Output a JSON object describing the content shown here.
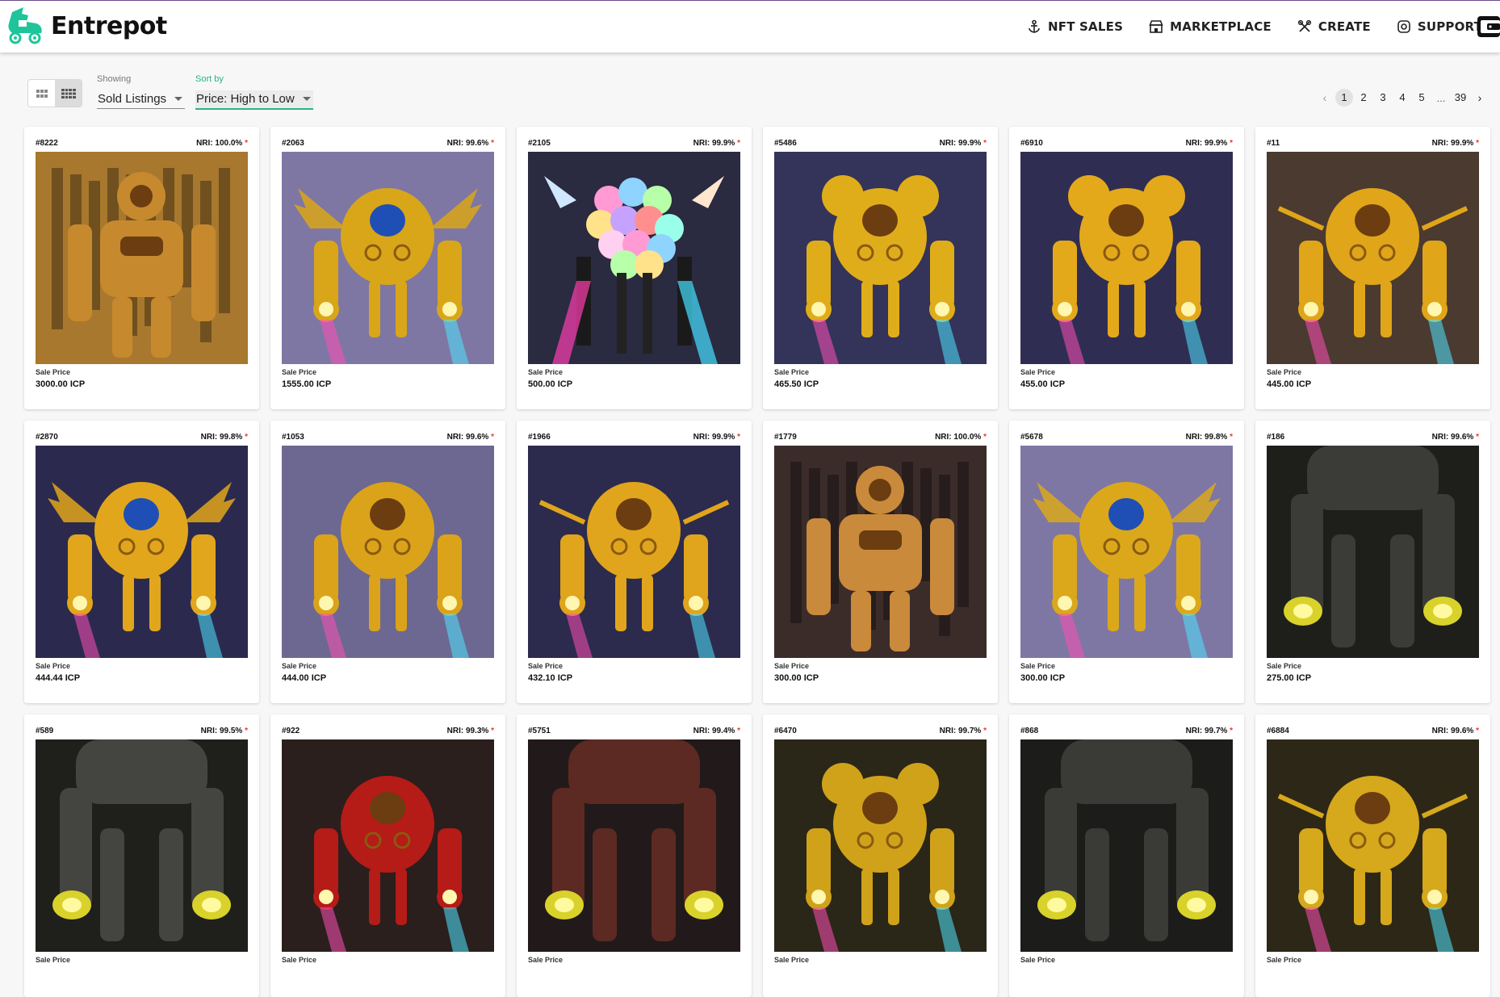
{
  "header": {
    "brand": "Entrepot",
    "brand_color": "#1ec59a",
    "nav": [
      {
        "label": "NFT SALES",
        "icon": "anchor-icon"
      },
      {
        "label": "MARKETPLACE",
        "icon": "store-icon"
      },
      {
        "label": "CREATE",
        "icon": "tools-icon"
      },
      {
        "label": "SUPPORT",
        "icon": "lifebuoy-icon"
      }
    ],
    "wallet_icon": "wallet-icon"
  },
  "toolbar": {
    "view_modes": [
      "large-grid-icon",
      "small-grid-icon"
    ],
    "showing_label": "Showing",
    "showing_value": "Sold Listings",
    "sort_label": "Sort by",
    "sort_value": "Price: High to Low",
    "accent": "#2bb28a"
  },
  "pagination": {
    "prev": "‹",
    "pages": [
      "1",
      "2",
      "3",
      "4",
      "5"
    ],
    "ellipsis": "...",
    "last": "39",
    "next": "›",
    "current": "1"
  },
  "cards": [
    {
      "id": "#8222",
      "nri": "NRI: 100.0%",
      "sale_label": "Sale Price",
      "price": "3000.00 ICP",
      "bg": "#a8782e",
      "body": "#c7892e",
      "variant": "ornate"
    },
    {
      "id": "#2063",
      "nri": "NRI: 99.6%",
      "sale_label": "Sale Price",
      "price": "1555.00 ICP",
      "bg": "#7e77a3",
      "body": "#d9a619",
      "variant": "winged"
    },
    {
      "id": "#2105",
      "nri": "NRI: 99.9%",
      "sale_label": "Sale Price",
      "price": "500.00 ICP",
      "bg": "#2a2a40",
      "body": "#9b7fd1",
      "variant": "balloons"
    },
    {
      "id": "#5486",
      "nri": "NRI: 99.9%",
      "sale_label": "Sale Price",
      "price": "465.50 ICP",
      "bg": "#343359",
      "body": "#e0ad1a",
      "variant": "eared"
    },
    {
      "id": "#6910",
      "nri": "NRI: 99.9%",
      "sale_label": "Sale Price",
      "price": "455.00 ICP",
      "bg": "#2f2e52",
      "body": "#e3a91b",
      "variant": "eared"
    },
    {
      "id": "#11",
      "nri": "NRI: 99.9%",
      "sale_label": "Sale Price",
      "price": "445.00 ICP",
      "bg": "#4a3a30",
      "body": "#e0a519",
      "variant": "spiked"
    },
    {
      "id": "#2870",
      "nri": "NRI: 99.8%",
      "sale_label": "Sale Price",
      "price": "444.44 ICP",
      "bg": "#2b2a4e",
      "body": "#e2a61c",
      "variant": "winged"
    },
    {
      "id": "#1053",
      "nri": "NRI: 99.6%",
      "sale_label": "Sale Price",
      "price": "444.00 ICP",
      "bg": "#6d6891",
      "body": "#dba31a",
      "variant": "tall"
    },
    {
      "id": "#1966",
      "nri": "NRI: 99.9%",
      "sale_label": "Sale Price",
      "price": "432.10 ICP",
      "bg": "#2c2b4d",
      "body": "#e0a51c",
      "variant": "spiked"
    },
    {
      "id": "#1779",
      "nri": "NRI: 100.0%",
      "sale_label": "Sale Price",
      "price": "300.00 ICP",
      "bg": "#3b2c2a",
      "body": "#c98a3c",
      "variant": "ornate"
    },
    {
      "id": "#5678",
      "nri": "NRI: 99.8%",
      "sale_label": "Sale Price",
      "price": "300.00 ICP",
      "bg": "#7e77a4",
      "body": "#dba81c",
      "variant": "winged"
    },
    {
      "id": "#186",
      "nri": "NRI: 99.6%",
      "sale_label": "Sale Price",
      "price": "275.00 ICP",
      "bg": "#1e1f1a",
      "body": "#3b3b38",
      "variant": "dark"
    },
    {
      "id": "#589",
      "nri": "NRI: 99.5%",
      "sale_label": "Sale Price",
      "price": "",
      "bg": "#1f1f1c",
      "body": "#444440",
      "variant": "dark"
    },
    {
      "id": "#922",
      "nri": "NRI: 99.3%",
      "sale_label": "Sale Price",
      "price": "",
      "bg": "#2a1f1d",
      "body": "#b51b17",
      "variant": "tall"
    },
    {
      "id": "#5751",
      "nri": "NRI: 99.4%",
      "sale_label": "Sale Price",
      "price": "",
      "bg": "#221a1a",
      "body": "#5c2a22",
      "variant": "dark"
    },
    {
      "id": "#6470",
      "nri": "NRI: 99.7%",
      "sale_label": "Sale Price",
      "price": "",
      "bg": "#2a2618",
      "body": "#cfa21a",
      "variant": "eared"
    },
    {
      "id": "#868",
      "nri": "NRI: 99.7%",
      "sale_label": "Sale Price",
      "price": "",
      "bg": "#1c1c1a",
      "body": "#3a3a36",
      "variant": "dark"
    },
    {
      "id": "#6884",
      "nri": "NRI: 99.6%",
      "sale_label": "Sale Price",
      "price": "",
      "bg": "#2d2717",
      "body": "#d6a81b",
      "variant": "spiked"
    }
  ]
}
